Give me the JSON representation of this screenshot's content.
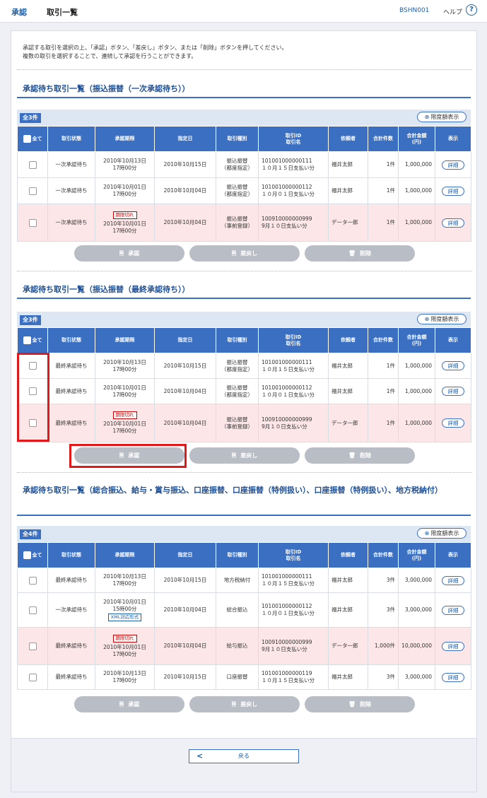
{
  "header": {
    "crumb_approve": "承認",
    "crumb_list": "取引一覧",
    "screen_id": "BSHN001",
    "help_label": "ヘルプ",
    "help_icon_glyph": "?"
  },
  "instructions": [
    "承認する取引を選択の上、「承認」ボタン、「差戻し」ボタン、または「削除」ボタンを押してください。",
    "複数の取引を選択することで、連続して承認を行うことができます。"
  ],
  "limit_label": "限度額表示",
  "columns": {
    "all": "全て",
    "status": "取引状態",
    "deadline": "承認期限",
    "date": "指定日",
    "type": "取引種別",
    "id1": "取引ID",
    "id2": "取引名",
    "requester": "依頼者",
    "count": "合計件数",
    "amt1": "合計金額",
    "amt2": "(円)",
    "show": "表示"
  },
  "actions": {
    "approve": "承認",
    "remand": "差戻し",
    "delete": "削除"
  },
  "detail_label": "詳細",
  "expired_label": "期限切れ",
  "xml_label": "XML対応形式",
  "back_label": "戻る",
  "colors": {
    "accent": "#3b6fc2",
    "pink": "#fde6e8",
    "highlight": "#e0191c"
  },
  "sections": [
    {
      "title": "承認待ち取引一覧（振込振替（一次承認待ち））",
      "count": "全3件",
      "rows": [
        {
          "status": "一次承認待ち",
          "deadline": [
            "2010年10月13日",
            "17時00分"
          ],
          "date": "2010年10月15日",
          "type": [
            "振込振替",
            "（都度指定）"
          ],
          "tid": "101001000000111",
          "tname": "１０月１５日支払い分",
          "requester": "福井太郎",
          "count": "1件",
          "amount": "1,000,000",
          "expired": false
        },
        {
          "status": "一次承認待ち",
          "deadline": [
            "2010年10月01日",
            "17時00分"
          ],
          "date": "2010年10月04日",
          "type": [
            "振込振替",
            "（都度指定）"
          ],
          "tid": "101001000000112",
          "tname": "１０月０１日支払い分",
          "requester": "福井太郎",
          "count": "1件",
          "amount": "1,000,000",
          "expired": false
        },
        {
          "status": "一次承認待ち",
          "deadline": [
            "2010年10月01日",
            "17時00分"
          ],
          "date": "2010年10月04日",
          "type": [
            "振込振替",
            "（事前登録）"
          ],
          "tid": "100910000000999",
          "tname": "9月１０日支払い分",
          "requester": "データ一郎",
          "count": "1件",
          "amount": "1,000,000",
          "expired": true
        }
      ]
    },
    {
      "title": "承認待ち取引一覧（振込振替（最終承認待ち））",
      "count": "全3件",
      "rows": [
        {
          "status": "最終承認待ち",
          "deadline": [
            "2010年10月13日",
            "17時00分"
          ],
          "date": "2010年10月15日",
          "type": [
            "振込振替",
            "（都度指定）"
          ],
          "tid": "101001000000111",
          "tname": "１０月１５日支払い分",
          "requester": "福井太郎",
          "count": "1件",
          "amount": "1,000,000",
          "expired": false
        },
        {
          "status": "最終承認待ち",
          "deadline": [
            "2010年10月01日",
            "17時00分"
          ],
          "date": "2010年10月04日",
          "type": [
            "振込振替",
            "（都度指定）"
          ],
          "tid": "101001000000112",
          "tname": "１０月０１日支払い分",
          "requester": "福井太郎",
          "count": "1件",
          "amount": "1,000,000",
          "expired": false
        },
        {
          "status": "最終承認待ち",
          "deadline": [
            "2010年10月01日",
            "17時00分"
          ],
          "date": "2010年10月04日",
          "type": [
            "振込振替",
            "（事前登録）"
          ],
          "tid": "100910000000999",
          "tname": "9月１０日支払い分",
          "requester": "データ一郎",
          "count": "1件",
          "amount": "1,000,000",
          "expired": true
        }
      ]
    },
    {
      "title": "承認待ち取引一覧（総合振込、給与・賞与振込、口座振替、口座振替（特例扱い）、口座振替（特例扱い）、地方税納付）",
      "count": "全4件",
      "rows": [
        {
          "status": "最終承認待ち",
          "deadline": [
            "2010年10月13日",
            "17時00分"
          ],
          "date": "2010年10月15日",
          "type": [
            "地方税納付"
          ],
          "tid": "101001000000111",
          "tname": "１０月１５日支払い分",
          "requester": "福井太郎",
          "count": "3件",
          "amount": "3,000,000",
          "expired": false,
          "xml": false
        },
        {
          "status": "一次承認待ち",
          "deadline": [
            "2010年10月01日",
            "15時00分"
          ],
          "date": "2010年10月04日",
          "type": [
            "総合振込"
          ],
          "tid": "101001000000112",
          "tname": "１０月０１日支払い分",
          "requester": "福井太郎",
          "count": "3件",
          "amount": "3,000,000",
          "expired": false,
          "xml": true
        },
        {
          "status": "最終承認待ち",
          "deadline": [
            "2010年10月01日",
            "17時00分"
          ],
          "date": "2010年10月04日",
          "type": [
            "給与振込"
          ],
          "tid": "100910000000999",
          "tname": "9月１０日支払い分",
          "requester": "データ一郎",
          "count": "1,000件",
          "amount": "10,000,000",
          "expired": true,
          "xml": false
        },
        {
          "status": "最終承認待ち",
          "deadline": [
            "2010年10月13日",
            "17時00分"
          ],
          "date": "2010年10月15日",
          "type": [
            "口座振替"
          ],
          "tid": "101001000000119",
          "tname": "１０月１５日支払い分",
          "requester": "福井太郎",
          "count": "3件",
          "amount": "3,000,000",
          "expired": false,
          "xml": false
        }
      ]
    }
  ]
}
